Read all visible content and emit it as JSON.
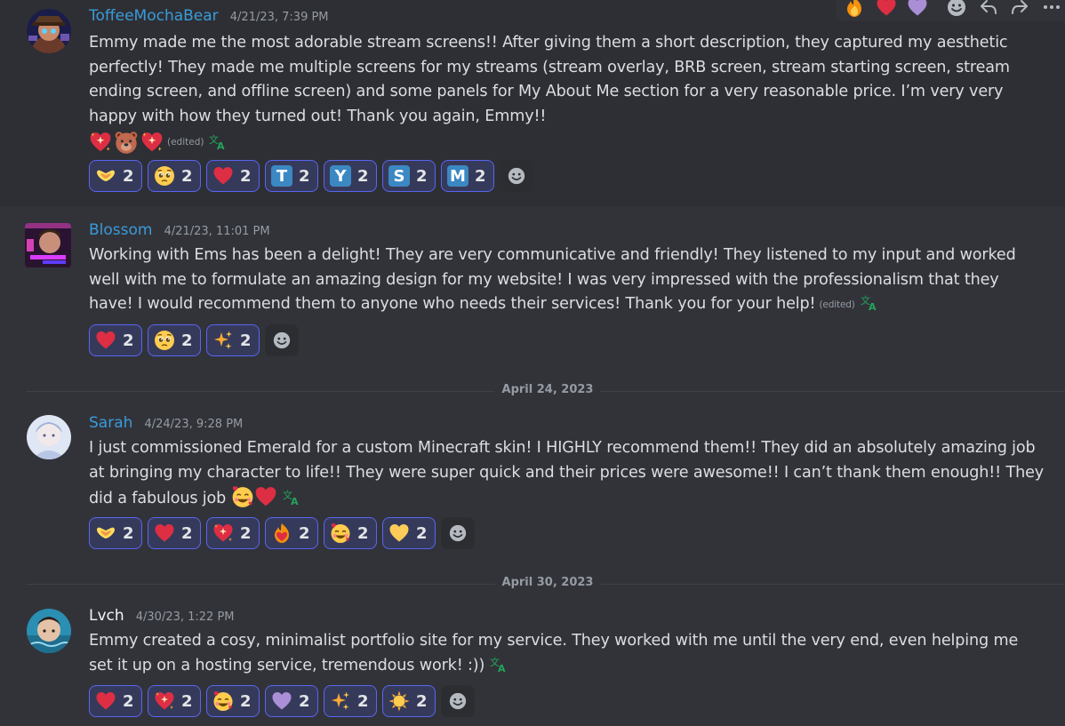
{
  "toolbar": {
    "quick_reactions": [
      "fire-emoji",
      "red-heart-emoji",
      "purple-heart-emoji"
    ],
    "actions": [
      "add-reaction",
      "reply",
      "forward",
      "more"
    ]
  },
  "messages": [
    {
      "username": "ToffeeMochaBear",
      "timestamp": "4/21/23, 7:39 PM",
      "text": "Emmy made me the most adorable stream screens!! After giving them a short description, they captured my aesthetic perfectly! They made me multiple screens for my streams (stream overlay, BRB screen, stream starting screen, stream ending screen, and offline screen) and some panels for My About Me section for a very reasonable price. I’m very very happy with how they turned out! Thank you again, Emmy!!",
      "edited_label": "(edited)",
      "reactions": [
        {
          "emoji": "heart-hands",
          "count": "2"
        },
        {
          "emoji": "pleading-face",
          "count": "2"
        },
        {
          "emoji": "red-heart",
          "count": "2"
        },
        {
          "emoji": "letter-t",
          "letter": "T",
          "count": "2"
        },
        {
          "emoji": "letter-y",
          "letter": "Y",
          "count": "2"
        },
        {
          "emoji": "letter-s",
          "letter": "S",
          "count": "2"
        },
        {
          "emoji": "letter-m",
          "letter": "M",
          "count": "2"
        }
      ]
    },
    {
      "username": "Blossom",
      "timestamp": "4/21/23, 11:01 PM",
      "text": "Working with Ems has been a delight! They are very communicative and friendly! They listened to my input and worked well with me to formulate an amazing design for my website! I was very impressed with the professionalism that they have! I would recommend them to anyone who needs their services! Thank you for your help!",
      "edited_label": "(edited)",
      "reactions": [
        {
          "emoji": "red-heart",
          "count": "2"
        },
        {
          "emoji": "pleading-face",
          "count": "2"
        },
        {
          "emoji": "sparkles",
          "count": "2"
        }
      ]
    },
    {
      "username": "Sarah",
      "timestamp": "4/24/23, 9:28 PM",
      "text": "I just commissioned Emerald for a custom Minecraft skin! I HIGHLY recommend them!! They did an absolutely amazing job at bringing my character to life!! They were super quick and their prices were awesome!! I can’t thank them enough!! They did a fabulous job",
      "reactions": [
        {
          "emoji": "heart-hands",
          "count": "2"
        },
        {
          "emoji": "red-heart",
          "count": "2"
        },
        {
          "emoji": "sparkling-heart",
          "count": "2"
        },
        {
          "emoji": "heart-on-fire",
          "count": "2"
        },
        {
          "emoji": "smiling-face-with-hearts",
          "count": "2"
        },
        {
          "emoji": "yellow-heart",
          "count": "2"
        }
      ]
    },
    {
      "username": "Lvch",
      "timestamp": "4/30/23, 1:22 PM",
      "text": "Emmy created a cosy, minimalist portfolio site for my service. They worked with me until the very end, even helping me set it up on a hosting service, tremendous work! :))",
      "reactions": [
        {
          "emoji": "red-heart",
          "count": "2"
        },
        {
          "emoji": "sparkling-heart",
          "count": "2"
        },
        {
          "emoji": "smiling-face-with-hearts",
          "count": "2"
        },
        {
          "emoji": "purple-heart",
          "count": "2"
        },
        {
          "emoji": "sparkles",
          "count": "2"
        },
        {
          "emoji": "sun",
          "count": "2"
        }
      ]
    }
  ],
  "dividers": [
    "April 24, 2023",
    "April 30, 2023"
  ],
  "colors": {
    "background": "#323339",
    "link_username": "#3a9bd9",
    "reaction_border": "#5865f2",
    "reaction_bg": "#363a5a",
    "muted_text": "#949ba4"
  }
}
